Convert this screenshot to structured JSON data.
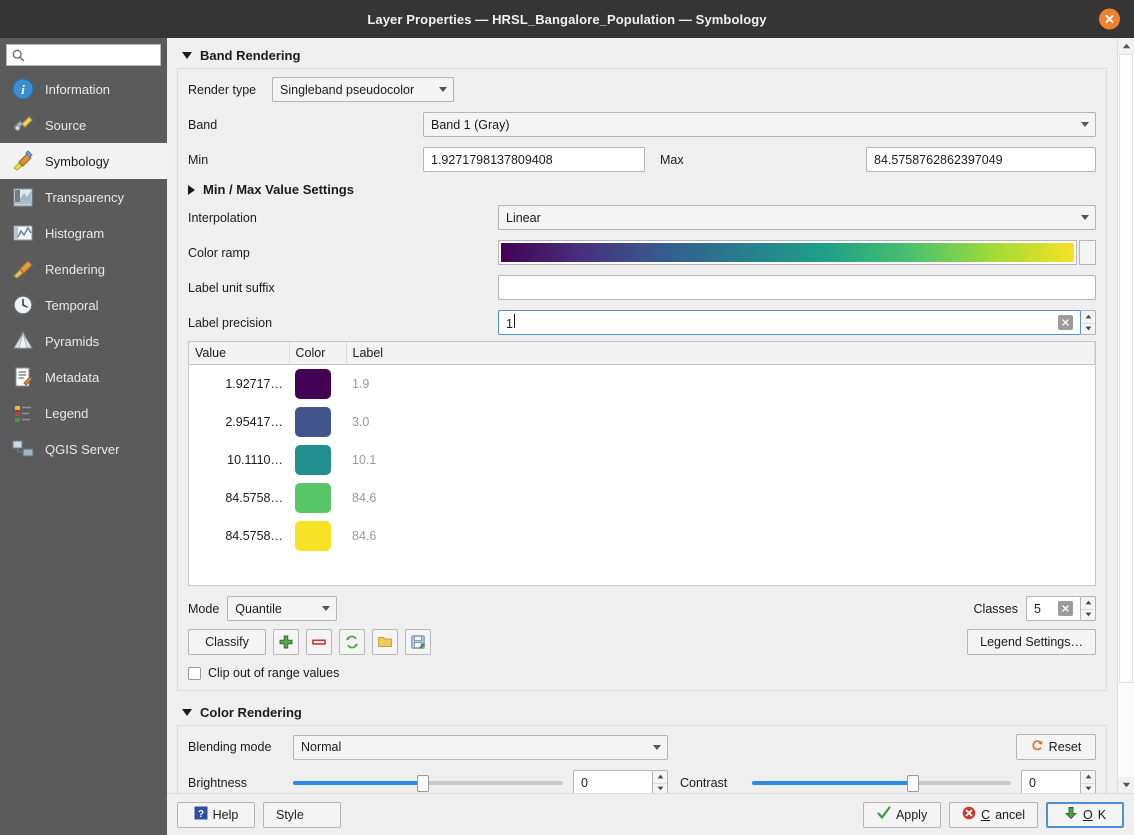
{
  "window": {
    "title": "Layer Properties — HRSL_Bangalore_Population — Symbology",
    "close_icon": "close-icon"
  },
  "sidebar": {
    "search_placeholder": "",
    "search_value": "",
    "items": [
      {
        "label": "Information",
        "icon": "information-icon",
        "active": false
      },
      {
        "label": "Source",
        "icon": "source-icon",
        "active": false
      },
      {
        "label": "Symbology",
        "icon": "symbology-icon",
        "active": true
      },
      {
        "label": "Transparency",
        "icon": "transparency-icon",
        "active": false
      },
      {
        "label": "Histogram",
        "icon": "histogram-icon",
        "active": false
      },
      {
        "label": "Rendering",
        "icon": "rendering-icon",
        "active": false
      },
      {
        "label": "Temporal",
        "icon": "temporal-icon",
        "active": false
      },
      {
        "label": "Pyramids",
        "icon": "pyramids-icon",
        "active": false
      },
      {
        "label": "Metadata",
        "icon": "metadata-icon",
        "active": false
      },
      {
        "label": "Legend",
        "icon": "legend-icon",
        "active": false
      },
      {
        "label": "QGIS Server",
        "icon": "qgis-server-icon",
        "active": false
      }
    ]
  },
  "band_rendering": {
    "section_title": "Band Rendering",
    "expanded": true,
    "render_type_label": "Render type",
    "render_type_value": "Singleband pseudocolor",
    "band_label": "Band",
    "band_value": "Band 1 (Gray)",
    "min_label": "Min",
    "min_value": "1.9271798137809408",
    "max_label": "Max",
    "max_value": "84.5758762862397049",
    "minmax_settings_title": "Min / Max Value Settings",
    "minmax_expanded": false,
    "interpolation_label": "Interpolation",
    "interpolation_value": "Linear",
    "color_ramp_label": "Color ramp",
    "color_ramp_name": "viridis",
    "label_unit_suffix_label": "Label unit suffix",
    "label_unit_suffix_value": "",
    "label_precision_label": "Label precision",
    "label_precision_value": "1"
  },
  "classification_table": {
    "headers": [
      "Value",
      "Color",
      "Label"
    ],
    "rows": [
      {
        "value": "1.92717…",
        "color": "#440154",
        "label": "1.9"
      },
      {
        "value": "2.95417…",
        "color": "#41548b",
        "label": "3.0"
      },
      {
        "value": "10.1110…",
        "color": "#218f8d",
        "label": "10.1"
      },
      {
        "value": "84.5758…",
        "color": "#56c667",
        "label": "84.6"
      },
      {
        "value": "84.5758…",
        "color": "#f7e225",
        "label": "84.6"
      }
    ]
  },
  "classify_bar": {
    "mode_label": "Mode",
    "mode_value": "Quantile",
    "classes_label": "Classes",
    "classes_value": "5",
    "classify_button": "Classify",
    "legend_settings_button": "Legend Settings…",
    "tool_icons": [
      "add-entry-icon",
      "remove-entry-icon",
      "sort-entries-icon",
      "load-color-map-icon",
      "save-color-map-icon"
    ],
    "clip_checkbox_label": "Clip out of range values",
    "clip_checked": false
  },
  "color_rendering": {
    "section_title": "Color Rendering",
    "expanded": true,
    "blending_mode_label": "Blending mode",
    "blending_mode_value": "Normal",
    "reset_button": "Reset",
    "brightness_label": "Brightness",
    "brightness_value": "0",
    "brightness_percent": 48,
    "contrast_label": "Contrast",
    "contrast_value": "0",
    "contrast_percent": 62
  },
  "footer": {
    "help_button": "Help",
    "style_button": "Style",
    "apply_button": "Apply",
    "cancel_button": "Cancel",
    "ok_button": "OK"
  },
  "colors": {
    "accent": "#2b8ae2",
    "titlebar": "#353535",
    "close": "#f0822e",
    "sidebar": "#5b5b5b",
    "panel": "#efefef"
  }
}
